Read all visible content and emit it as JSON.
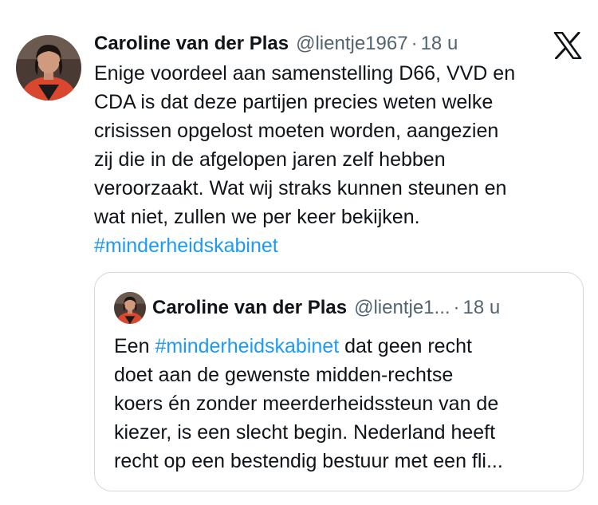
{
  "tweet": {
    "author_name": "Caroline van der Plas",
    "handle": "@lientje1967",
    "separator": "·",
    "time": "18 u",
    "platform_icon": "x-logo-icon",
    "avatar_icon": "profile-avatar",
    "lines": [
      {
        "text": "Enige voordeel aan samenstelling D66, VVD en"
      },
      {
        "text": "CDA is dat deze partijen precies weten welke"
      },
      {
        "text": "crisissen opgelost moeten worden, aangezien"
      },
      {
        "text": "zij die in de afgelopen jaren zelf hebben"
      },
      {
        "text": "veroorzaakt. Wat wij straks kunnen steunen en"
      },
      {
        "text": "wat niet, zullen we per keer bekijken."
      }
    ],
    "hashtag": "#minderheidskabinet"
  },
  "quote": {
    "author_name": "Caroline van der Plas",
    "handle": "@lientje1...",
    "separator": "·",
    "time": "18 u",
    "line1_prefix": "Een ",
    "line1_hashtag": "#minderheidskabinet",
    "line1_suffix": " dat geen recht",
    "lines": [
      {
        "text": "doet aan de gewenste midden-rechtse"
      },
      {
        "text": "koers én zonder meerderheidssteun van de"
      },
      {
        "text": "kiezer, is een slecht begin. Nederland heeft"
      },
      {
        "text": "recht op een bestendig bestuur met een fli..."
      }
    ]
  },
  "colors": {
    "text": "#0f1419",
    "secondary": "#536471",
    "link": "#1d9bf0",
    "border": "#cfd9de"
  }
}
